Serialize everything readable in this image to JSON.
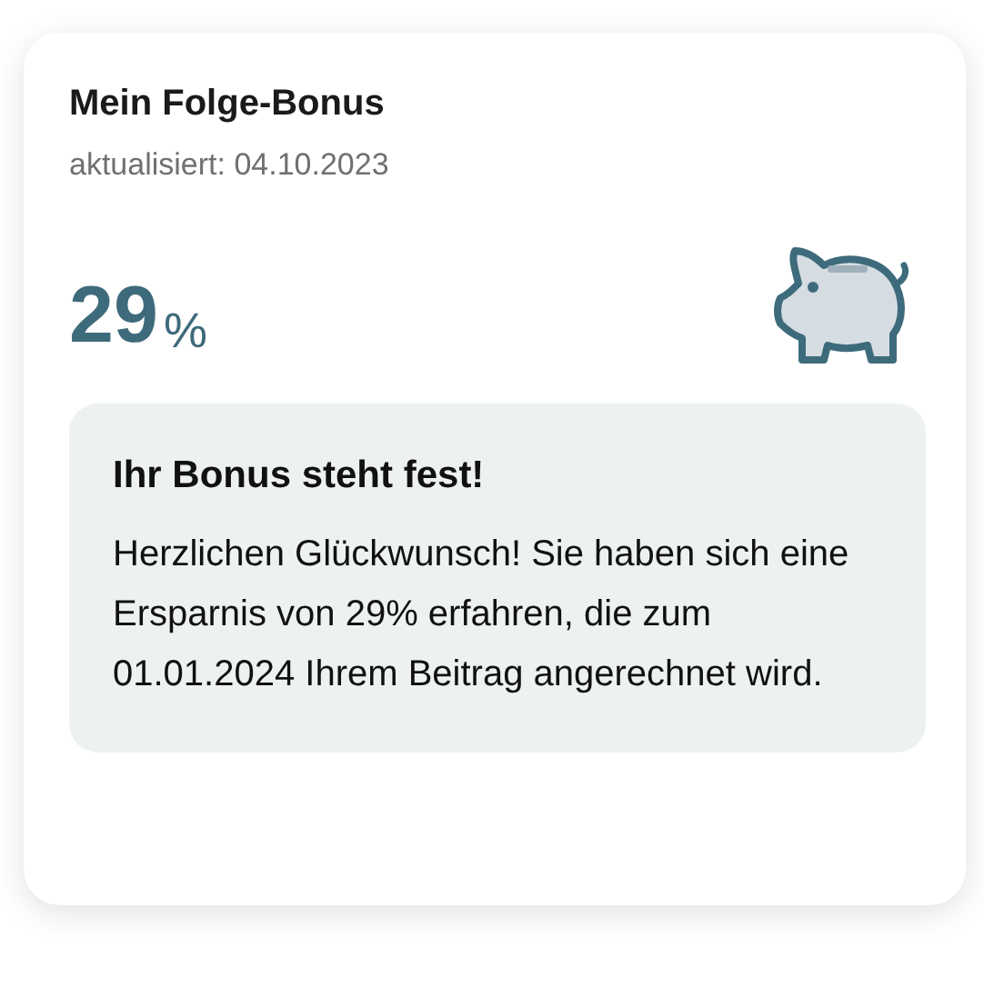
{
  "card": {
    "title": "Mein Folge-Bonus",
    "subtitle": "aktualisiert: 04.10.2023",
    "value": "29",
    "unit": "%",
    "notice": {
      "heading": "Ihr Bonus steht fest!",
      "body": "Herzlichen Glückwunsch! Sie haben sich eine Ersparnis von 29% erfahren, die zum 01.01.2024 Ihrem Beitrag angerechnet wird."
    }
  }
}
